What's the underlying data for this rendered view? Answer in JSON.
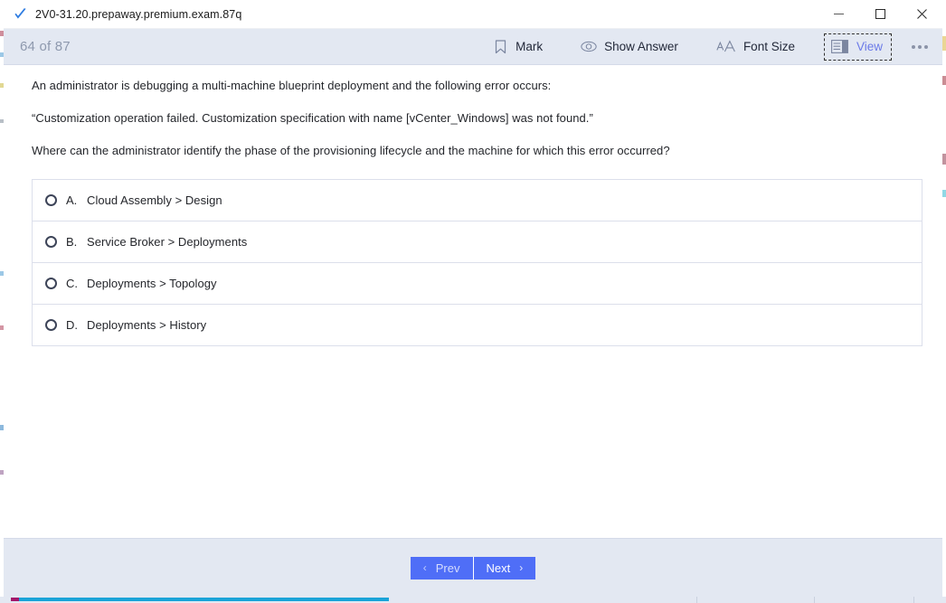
{
  "window": {
    "title": "2V0-31.20.prepaway.premium.exam.87q",
    "logo_icon": "blue-check-icon",
    "controls": {
      "minimize": "minimize-icon",
      "maximize": "maximize-icon",
      "close": "close-icon"
    }
  },
  "toolbar": {
    "progress_label": "64 of 87",
    "actions": [
      {
        "label": "Mark",
        "icon": "bookmark-icon"
      },
      {
        "label": "Show Answer",
        "icon": "eye-icon"
      },
      {
        "label": "Font Size",
        "icon": "font-size-icon"
      },
      {
        "label": "View",
        "icon": "layout-panel-icon"
      }
    ],
    "overflow_label": "•••"
  },
  "question": {
    "paragraphs": [
      "An administrator is debugging a multi-machine blueprint deployment and the following error occurs:",
      "“Customization operation failed. Customization specification with name [vCenter_Windows] was not found.”",
      "Where can the administrator identify the phase of the provisioning lifecycle and the machine for which this error occurred?"
    ]
  },
  "options": [
    {
      "letter": "A.",
      "text": "Cloud Assembly > Design",
      "selected": false
    },
    {
      "letter": "B.",
      "text": "Service Broker > Deployments",
      "selected": false
    },
    {
      "letter": "C.",
      "text": "Deployments > Topology",
      "selected": false
    },
    {
      "letter": "D.",
      "text": "Deployments > History",
      "selected": false
    }
  ],
  "footer": {
    "prev_label": "Prev",
    "next_label": "Next",
    "prev_chevron": "‹",
    "next_chevron": "›"
  },
  "colors": {
    "toolbar_bg": "#e3e8f2",
    "accent_blue": "#4f6ef7",
    "view_active": "#6b7ae8",
    "progress_text": "#8e99ae",
    "option_border": "#dcdfeb"
  }
}
